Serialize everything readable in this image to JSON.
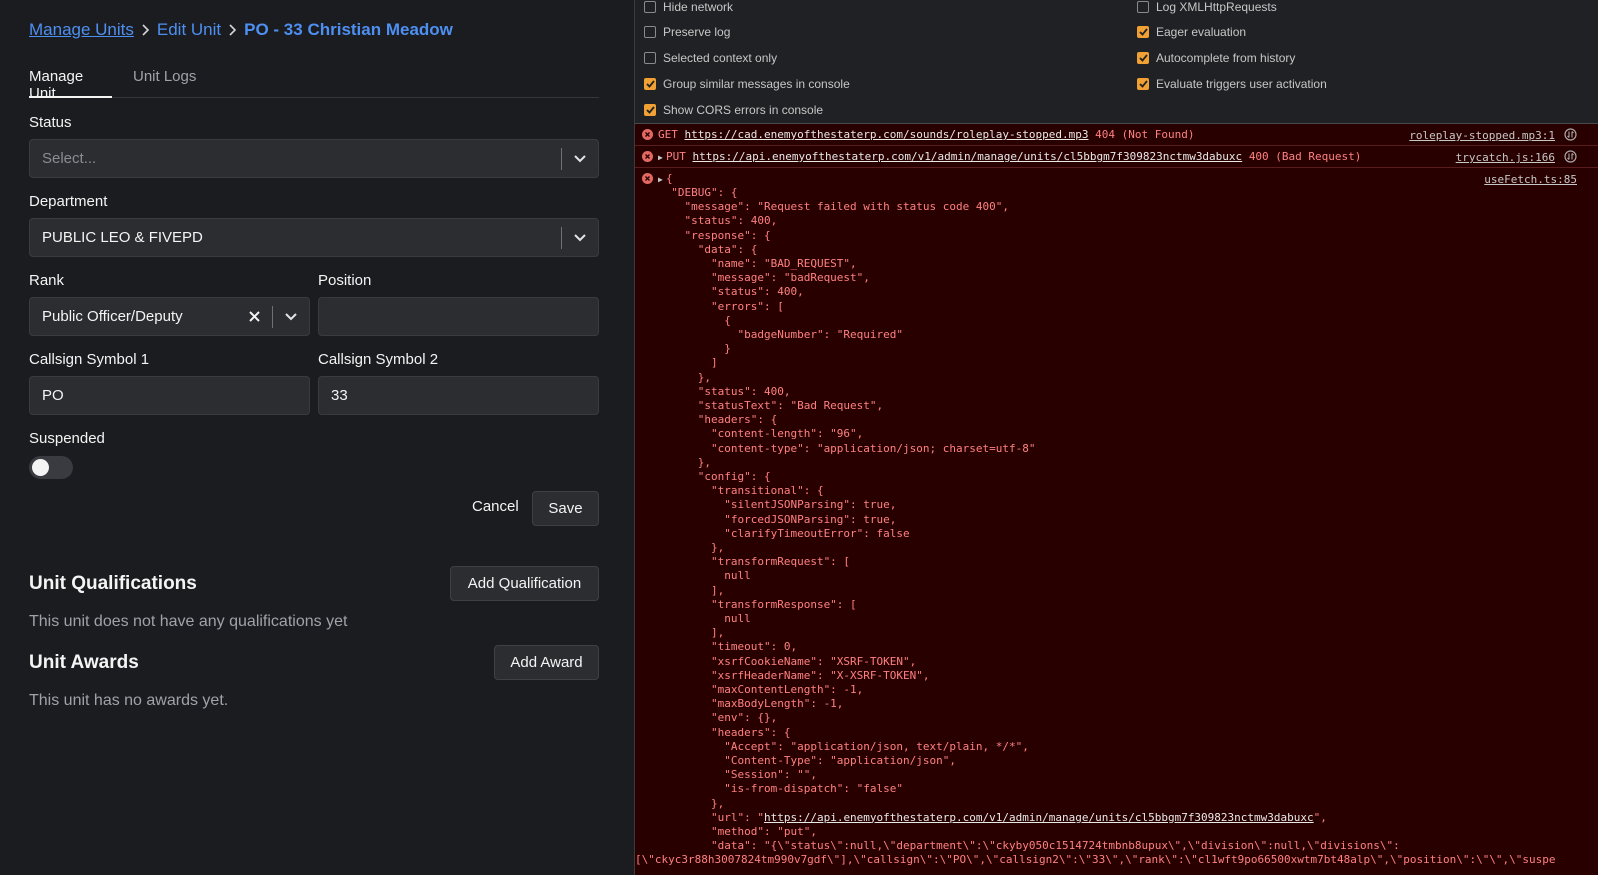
{
  "breadcrumb": {
    "manage_units": "Manage Units",
    "edit_unit": "Edit Unit",
    "current": "PO - 33 Christian Meadow"
  },
  "tabs": {
    "manage_unit": "Manage Unit",
    "unit_logs": "Unit Logs"
  },
  "form": {
    "status_label": "Status",
    "status_placeholder": "Select...",
    "department_label": "Department",
    "department_value": "PUBLIC LEO & FIVEPD",
    "rank_label": "Rank",
    "rank_value": "Public Officer/Deputy",
    "position_label": "Position",
    "position_value": "",
    "callsign1_label": "Callsign Symbol 1",
    "callsign1_value": "PO",
    "callsign2_label": "Callsign Symbol 2",
    "callsign2_value": "33",
    "suspended_label": "Suspended",
    "suspended": false,
    "cancel_label": "Cancel",
    "save_label": "Save"
  },
  "qualifications": {
    "title": "Unit Qualifications",
    "add_label": "Add Qualification",
    "empty_text": "This unit does not have any qualifications yet"
  },
  "awards": {
    "title": "Unit Awards",
    "add_label": "Add Award",
    "empty_text": "This unit has no awards yet."
  },
  "devtools": {
    "settings": {
      "hide_network": "Hide network",
      "preserve_log": "Preserve log",
      "selected_context_only": "Selected context only",
      "group_similar": "Group similar messages in console",
      "show_cors": "Show CORS errors in console",
      "log_xhr": "Log XMLHttpRequests",
      "eager_evaluation": "Eager evaluation",
      "autocomplete_history": "Autocomplete from history",
      "evaluate_triggers": "Evaluate triggers user activation"
    },
    "log": {
      "get_method": "GET",
      "get_url": "https://cad.enemyofthestaterp.com/sounds/roleplay-stopped.mp3",
      "get_status": "404 (Not Found)",
      "get_source": "roleplay-stopped.mp3:1",
      "put_method": "PUT",
      "put_url": "https://api.enemyofthestaterp.com/v1/admin/manage/units/cl5bbgm7f309823nctmw3dabuxc",
      "put_status": "400 (Bad Request)",
      "put_source": "trycatch.js:166",
      "obj_source": "useFetch.ts:85",
      "obj_open": "{",
      "url_value": "https://api.enemyofthestaterp.com/v1/admin/manage/units/cl5bbgm7f309823nctmw3dabuxc",
      "json_lines": [
        "  \"DEBUG\": {",
        "    \"message\": \"Request failed with status code 400\",",
        "    \"status\": 400,",
        "    \"response\": {",
        "      \"data\": {",
        "        \"name\": \"BAD_REQUEST\",",
        "        \"message\": \"badRequest\",",
        "        \"status\": 400,",
        "        \"errors\": [",
        "          {",
        "            \"badgeNumber\": \"Required\"",
        "          }",
        "        ]",
        "      },",
        "      \"status\": 400,",
        "      \"statusText\": \"Bad Request\",",
        "      \"headers\": {",
        "        \"content-length\": \"96\",",
        "        \"content-type\": \"application/json; charset=utf-8\"",
        "      },",
        "      \"config\": {",
        "        \"transitional\": {",
        "          \"silentJSONParsing\": true,",
        "          \"forcedJSONParsing\": true,",
        "          \"clarifyTimeoutError\": false",
        "        },",
        "        \"transformRequest\": [",
        "          null",
        "        ],",
        "        \"transformResponse\": [",
        "          null",
        "        ],",
        "        \"timeout\": 0,",
        "        \"xsrfCookieName\": \"XSRF-TOKEN\",",
        "        \"xsrfHeaderName\": \"X-XSRF-TOKEN\",",
        "        \"maxContentLength\": -1,",
        "        \"maxBodyLength\": -1,",
        "        \"env\": {},",
        "        \"headers\": {",
        "          \"Accept\": \"application/json, text/plain, */*\",",
        "          \"Content-Type\": \"application/json\",",
        "          \"Session\": \"\",",
        "          \"is-from-dispatch\": \"false\"",
        "        },"
      ],
      "url_prefix": "        \"url\": \"",
      "url_suffix": "\",",
      "tail_lines": [
        "        \"method\": \"put\",",
        "        \"data\": \"{\\\"status\\\":null,\\\"department\\\":\\\"ckyby050c1514724tmbnb8upux\\\",\\\"division\\\":null,\\\"divisions\\\":",
        "[\\\"ckyc3r88h3007824tm990v7gdf\\\"],\\\"callsign\\\":\\\"PO\\\",\\\"callsign2\\\":\\\"33\\\",\\\"rank\\\":\\\"cl1wft9po66500xwtm7bt48alp\\\",\\\"position\\\":\\\"\\\",\\\"suspe"
      ]
    }
  },
  "colors": {
    "accent_link": "#4e8ff2",
    "checkbox_checked": "#f1a033",
    "error_text": "#ff8080",
    "error_bg": "#290000"
  }
}
